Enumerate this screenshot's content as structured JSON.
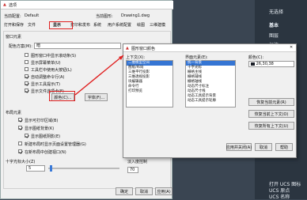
{
  "options": {
    "title": "选项",
    "current_profile_label": "当前配置:",
    "current_profile": "Default",
    "current_drawing_label": "当前图形:",
    "current_drawing": "Drawing1.dwg",
    "tabs": [
      "打开和保存",
      "文件",
      "显示",
      "打印和发布",
      "系统",
      "用户系统配置",
      "绘图",
      "三维建模",
      "选择集",
      "配置"
    ],
    "window_elements_label": "窗口元素",
    "color_scheme_label": "配色方案(M):",
    "color_scheme": "暗",
    "window_checks": [
      "图形窗口中显示滚动条(S)",
      "显示屏幕菜单(U)",
      "工具栏中使用大按钮(L)",
      "自动调整命令行(A)",
      "显示工具提示(T)",
      "显示文件选项卡(F)"
    ],
    "colors_button": "颜色(C)...",
    "fonts_button": "字体(F)...",
    "layout_elements_label": "布局元素",
    "layout_checks": [
      "显示可打印区域(B)",
      "显示图纸背景(K)",
      "显示图纸阴影(E)",
      "新建布局时显示页面设置管理器(G)",
      "在新布局中创建视口(N)"
    ],
    "crosshair_label": "十字光标大小(Z)",
    "crosshair_value": "5",
    "display_precision_label": "显示精度",
    "fade_label": "淡入度控制",
    "fade_value": "70",
    "ok": "确定",
    "cancel": "取消",
    "apply": "应用(A)",
    "help": "帮助(H)"
  },
  "color_dialog": {
    "title": "图形窗口颜色",
    "context_label": "上下文(X):",
    "contexts": [
      "二维模型空间",
      "图纸/布局",
      "三维平行投影",
      "三维透视投影",
      "块编辑器",
      "命令行",
      "打印预览"
    ],
    "elements_label": "界面元素(E):",
    "elements": [
      "统一背景",
      "十字光标",
      "栅格主线",
      "栅格辅线",
      "栅格轴线",
      "动态尺寸标注",
      "动态尺寸线",
      "动态工具提示背景",
      "动态工具提示轮廓",
      "动态工具提示背景"
    ],
    "color_label": "颜色(C):",
    "color_value": "26,30,38",
    "restore_element": "恢复当前元素(R)",
    "restore_context": "恢复当前上下文(O)",
    "restore_all": "恢复所有上下文(U)",
    "restore_classic": "恢复传统颜色(L)",
    "apply_close": "应用并关闭(A)",
    "cancel": "取消",
    "help": "帮助",
    "preview_label": "预览:"
  },
  "right_panel": {
    "items": [
      "无选择",
      "基本",
      "图层",
      "标注",
      "打开 UCS 图标",
      "UCS 原点",
      "UCS 名称"
    ]
  }
}
